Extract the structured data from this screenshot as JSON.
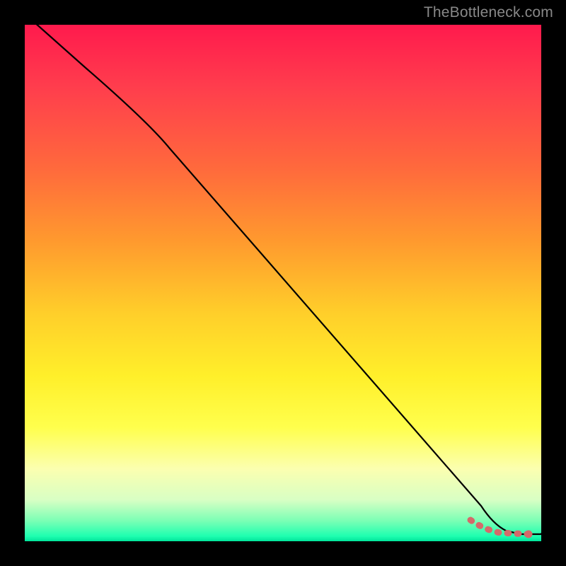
{
  "watermark": "TheBottleneck.com",
  "chart_data": {
    "type": "line",
    "title": "",
    "xlabel": "",
    "ylabel": "",
    "xlim": [
      0,
      100
    ],
    "ylim": [
      0,
      100
    ],
    "grid": false,
    "legend": false,
    "background": "vertical-gradient red→yellow→green",
    "series": [
      {
        "name": "curve",
        "stroke": "#000000",
        "x": [
          0,
          12,
          25,
          30,
          40,
          50,
          60,
          70,
          80,
          85,
          88,
          92,
          96,
          100
        ],
        "values": [
          100,
          90,
          80,
          75,
          61,
          48,
          34,
          20,
          6.5,
          2.5,
          1.0,
          0.5,
          0.5,
          5
        ]
      }
    ],
    "highlight_segment": {
      "color": "#d46a6a",
      "x": [
        85,
        88,
        90,
        92,
        94,
        95.5
      ],
      "values": [
        2.5,
        1.0,
        0.7,
        0.5,
        0.5,
        0.5
      ],
      "end_dot": {
        "x": 95.5,
        "y": 0.5,
        "r": 3.5
      }
    }
  }
}
